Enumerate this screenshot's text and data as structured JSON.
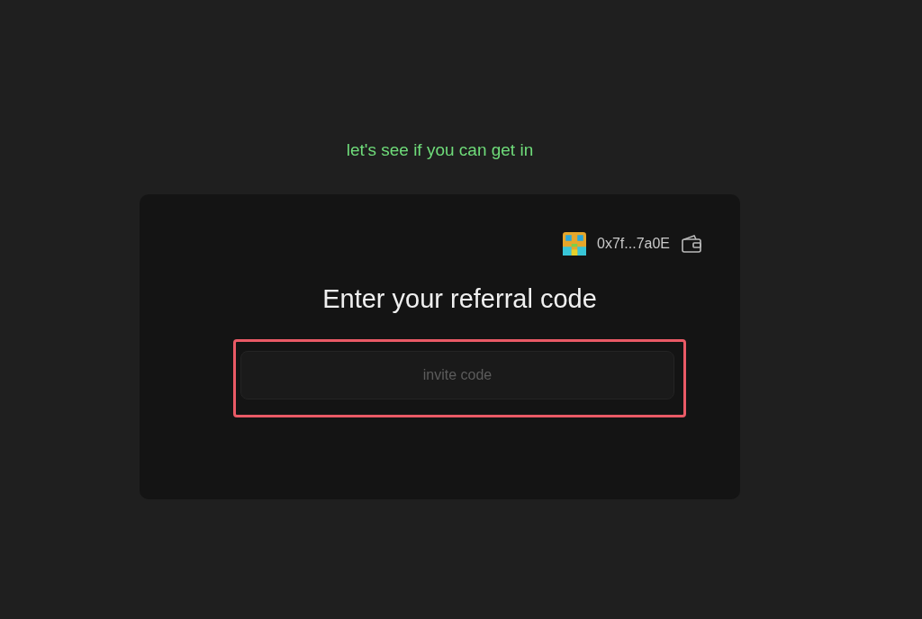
{
  "tagline": "let's see if you can get in",
  "wallet": {
    "address": "0x7f...7a0E"
  },
  "heading": "Enter your referral code",
  "code_field": {
    "placeholder": "invite code",
    "highlighted": true
  }
}
